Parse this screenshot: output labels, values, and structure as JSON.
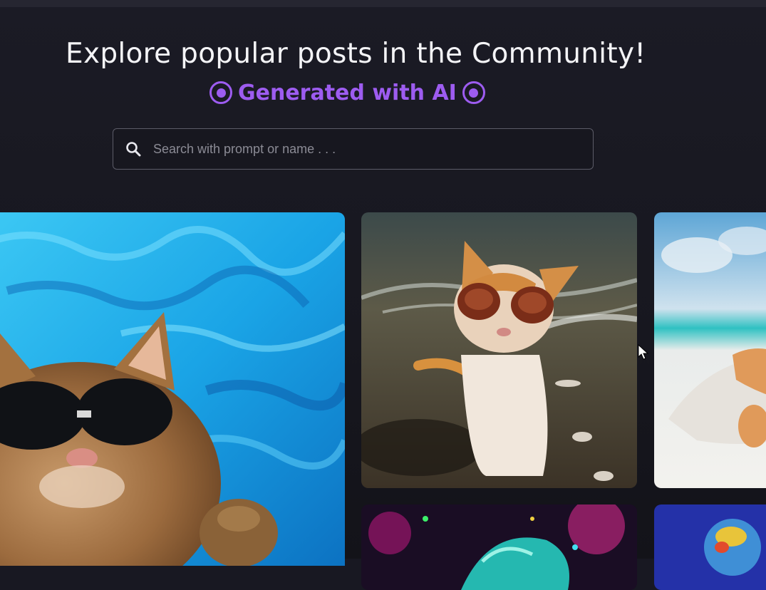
{
  "header": {
    "title": "Explore popular posts in the Community!",
    "subtitle": "Generated with AI"
  },
  "search": {
    "placeholder": "Search with prompt or name . . ."
  },
  "colors": {
    "accent": "#9d5cf0",
    "background": "#181822"
  },
  "gallery": {
    "cards": [
      {
        "id": "cat-pool-sunglasses",
        "subject": "cat with sunglasses in pool"
      },
      {
        "id": "cat-beach-sunglasses",
        "subject": "cat with sunglasses on beach"
      },
      {
        "id": "cat-lying-beach",
        "subject": "cat lying on beach"
      },
      {
        "id": "colorful-fantasy",
        "subject": "colorful fantasy art"
      },
      {
        "id": "cartoon-blue",
        "subject": "cartoon art"
      }
    ]
  }
}
